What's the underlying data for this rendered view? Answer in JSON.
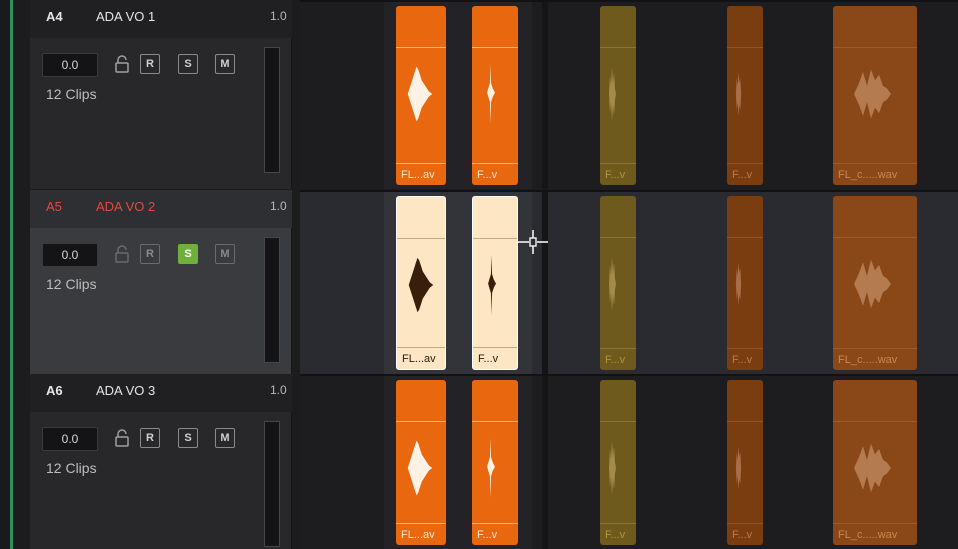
{
  "tracks": [
    {
      "id": "A4",
      "name": "ADA VO 1",
      "level": "1.0",
      "volume": "0.0",
      "clips_text": "12 Clips",
      "selected": false,
      "buttons": {
        "r": "R",
        "s": "S",
        "m": "M"
      },
      "solo_on": false,
      "clip_labels": [
        "FL...av",
        "F...v",
        "F...v",
        "F...v",
        "FL_c.....wav"
      ]
    },
    {
      "id": "A5",
      "name": "ADA VO 2",
      "level": "1.0",
      "volume": "0.0",
      "clips_text": "12 Clips",
      "selected": true,
      "buttons": {
        "r": "R",
        "s": "S",
        "m": "M"
      },
      "solo_on": true,
      "clip_labels": [
        "FL...av",
        "F...v",
        "F...v",
        "F...v",
        "FL_c.....wav"
      ]
    },
    {
      "id": "A6",
      "name": "ADA VO 3",
      "level": "1.0",
      "volume": "0.0",
      "clips_text": "12 Clips",
      "selected": false,
      "buttons": {
        "r": "R",
        "s": "S",
        "m": "M"
      },
      "solo_on": false,
      "clip_labels": [
        "FL...av",
        "F...v",
        "F...v",
        "F...v",
        "FL_c.....wav"
      ]
    }
  ],
  "colors": {
    "clip_orange": "#e8670f",
    "clip_selected": "#fde6c4",
    "clip_dim_olive": "#6e5a1d",
    "clip_dim_brown": "#7a3d10",
    "clip_dim_orange": "#8a4818",
    "solo_green": "#6fb03a",
    "selected_track_red": "#e5493a",
    "timeline_green_line": "#2f8f5a"
  },
  "icons": {
    "lock": "lock-icon",
    "cursor": "trim-crosshair-cursor-icon"
  }
}
